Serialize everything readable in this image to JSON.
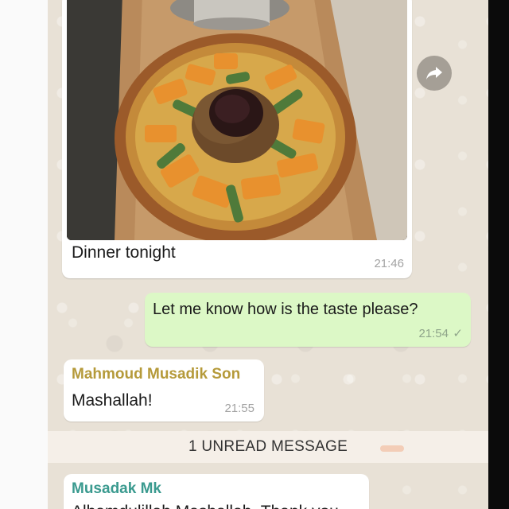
{
  "messages": {
    "image_caption": "Dinner tonight",
    "image_time": "21:46",
    "outgoing_text": "Let me know how is the taste please?",
    "outgoing_time": "21:54",
    "outgoing_status": "✓",
    "incoming_sender": "Mahmoud  Musadik Son",
    "incoming_text": "Mashallah!",
    "incoming_time": "21:55",
    "unread_label": "1 UNREAD MESSAGE",
    "last_sender": "Musadak Mk",
    "last_text": "Alhamdulillah Mashallah. Thank you"
  },
  "icons": {
    "forward": "forward-arrow-icon"
  },
  "colors": {
    "outgoing_bubble": "#dcf8c6",
    "sender_1": "#b59a3a",
    "sender_2": "#3a9a8f",
    "chat_background": "#e8e1d6"
  }
}
